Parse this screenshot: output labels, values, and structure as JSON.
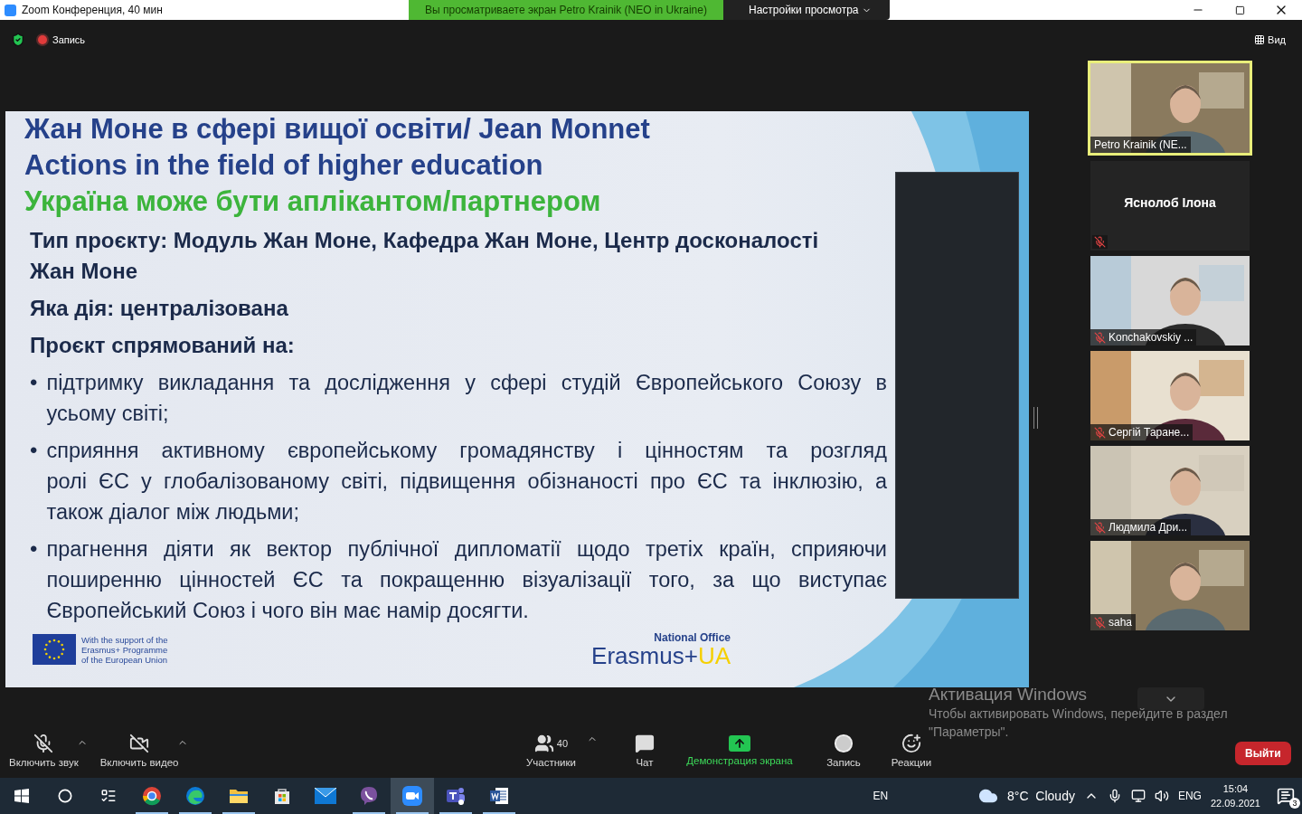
{
  "window": {
    "title": "Zoom Конференция, 40 мин"
  },
  "share_banner": {
    "text": "Вы просматриваете экран Petro Krainik (NEO in Ukraine)",
    "button": "Настройки просмотра"
  },
  "top_bar": {
    "recording": "Запись",
    "view": "Вид"
  },
  "slide": {
    "title_lines": [
      "Жан Моне в сфері вищої освіти/ Jean Monnet",
      "Actions in the field of higher education"
    ],
    "subtitle": "Україна може бути аплікантом/партнером",
    "paragraphs": [
      {
        "kind": "heading",
        "lines": [
          "Тип проєкту: Модуль Жан Моне, Кафедра Жан Моне, Центр досконалості",
          "Жан Моне"
        ]
      },
      {
        "kind": "heading",
        "lines": [
          "Яка дія: централізована"
        ]
      },
      {
        "kind": "heading",
        "lines": [
          "Проєкт спрямований на:"
        ]
      },
      {
        "kind": "bullet",
        "marker": "•",
        "lines": [
          "підтримку викладання та дослідження у сфері студій Європейського Союзу в",
          "усьому світі;"
        ]
      },
      {
        "kind": "bullet",
        "marker": "•",
        "lines": [
          "сприяння активному європейському громадянству і цінностям та розгляд",
          "ролі ЄС у глобалізованому світі, підвищення обізнаності про ЄС та інклюзію, а",
          "також діалог між людьми;"
        ]
      },
      {
        "kind": "bullet",
        "marker": "•",
        "lines": [
          "прагнення діяти як вектор публічної дипломатії щодо третіх країн, сприяючи",
          "поширенню цінностей ЄС та покращенню візуалізації того, за що виступає",
          "Європейський Союз і чого він має намір досягти."
        ]
      }
    ],
    "footer": {
      "eu_lines": [
        "With the support of the",
        "Erasmus+ Programme",
        "of the European Union"
      ],
      "office": "National Office",
      "brand": "Erasmus+",
      "brand_suffix": "UA"
    }
  },
  "participants": [
    {
      "name": "Petro Krainik (NE...",
      "video": true,
      "speaking": true,
      "muted": false
    },
    {
      "name": "Яснолоб Ілона",
      "video": false,
      "speaking": false,
      "muted": true
    },
    {
      "name": "Konchakovskiy ...",
      "video": true,
      "speaking": false,
      "muted": true
    },
    {
      "name": "Сергій Таране...",
      "video": true,
      "speaking": false,
      "muted": true
    },
    {
      "name": "Людмила Дри...",
      "video": true,
      "speaking": false,
      "muted": true
    },
    {
      "name": "saha",
      "video": true,
      "speaking": false,
      "muted": true
    }
  ],
  "toolbar": {
    "audio": {
      "label": "Включить звук",
      "muted": true
    },
    "video": {
      "label": "Включить видео",
      "muted": true
    },
    "center": [
      {
        "kind": "participants",
        "label": "Участники",
        "count": "40"
      },
      {
        "kind": "chat",
        "label": "Чат"
      },
      {
        "kind": "share",
        "label": "Демонстрация экрана"
      },
      {
        "kind": "record",
        "label": "Запись"
      },
      {
        "kind": "reactions",
        "label": "Реакции"
      }
    ],
    "leave": "Выйти"
  },
  "activation": {
    "title": "Активация Windows",
    "text": "Чтобы активировать Windows, перейдите в раздел \"Параметры\"."
  },
  "taskbar": {
    "apps": [
      {
        "kind": "chrome",
        "running": true,
        "active": false
      },
      {
        "kind": "edge",
        "running": true,
        "active": false
      },
      {
        "kind": "explorer",
        "running": true,
        "active": false
      },
      {
        "kind": "store",
        "running": false,
        "active": false
      },
      {
        "kind": "mail",
        "running": false,
        "active": false
      },
      {
        "kind": "viber",
        "running": true,
        "active": false
      },
      {
        "kind": "zoom",
        "running": true,
        "active": true
      },
      {
        "kind": "teams",
        "running": true,
        "active": false
      },
      {
        "kind": "word",
        "running": true,
        "active": false
      }
    ],
    "input_indicator": "EN",
    "weather": "8°C  Cloudy",
    "language": "ENG",
    "time": "15:04",
    "date": "22.09.2021",
    "notifications": "3"
  }
}
